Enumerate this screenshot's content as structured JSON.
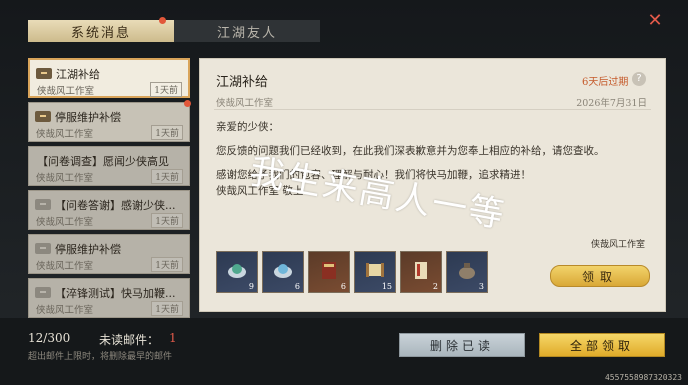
{
  "tabs": [
    {
      "label": "系统消息",
      "active": true,
      "has_dot": true
    },
    {
      "label": "江湖友人",
      "active": false,
      "has_dot": false
    }
  ],
  "close_icon": "close-icon",
  "mail_list": [
    {
      "title": "江湖补给",
      "sender": "侠哉风工作室",
      "time": "1天前",
      "selected": true,
      "read": false,
      "has_dot": false
    },
    {
      "title": "停服维护补偿",
      "sender": "侠哉风工作室",
      "time": "1天前",
      "selected": false,
      "read": false,
      "has_dot": true
    },
    {
      "title": "【问卷调查】愿闻少侠高见",
      "sender": "侠哉风工作室",
      "time": "1天前",
      "selected": false,
      "read": true,
      "has_dot": false
    },
    {
      "title": "【问卷答谢】感谢少侠...",
      "sender": "侠哉风工作室",
      "time": "1天前",
      "selected": false,
      "read": true,
      "has_dot": false
    },
    {
      "title": "停服维护补偿",
      "sender": "侠哉风工作室",
      "time": "1天前",
      "selected": false,
      "read": true,
      "has_dot": false
    },
    {
      "title": "【淬锋测试】快马加鞭...",
      "sender": "侠哉风工作室",
      "time": "1天前",
      "selected": false,
      "read": true,
      "has_dot": false
    }
  ],
  "detail": {
    "title": "江湖补给",
    "expire": "6天后过期",
    "help_icon": "?",
    "sender": "侠哉风工作室",
    "date": "2026年7月31日",
    "greeting": "亲爱的少侠：",
    "body1": "您反馈的问题我们已经收到，在此我们深表歉意并为您奉上相应的补给，请您查收。",
    "body2": "感谢您给予我们的包容、理解与耐心！我们将快马加鞭，追求精进！",
    "body3": "侠哉风工作室 敬上",
    "signature": "侠哉风工作室",
    "claim_label": "领取",
    "attachments": [
      {
        "icon": "jade-orb-icon",
        "count": "9",
        "bg": "blue"
      },
      {
        "icon": "pearl-orb-icon",
        "count": "6",
        "bg": "blue"
      },
      {
        "icon": "book-icon",
        "count": "6",
        "bg": "brown"
      },
      {
        "icon": "scroll-icon",
        "count": "15",
        "bg": "blue"
      },
      {
        "icon": "manual-icon",
        "count": "2",
        "bg": "brown"
      },
      {
        "icon": "pouch-icon",
        "count": "3",
        "bg": "blue"
      }
    ]
  },
  "overlay_text": "我生来高人一等",
  "footer": {
    "count": "12/300",
    "unread_label": "未读邮件：",
    "unread_count": "1",
    "hint": "超出邮件上限时，将删除最早的邮件",
    "delete_read_label": "删除已读",
    "claim_all_label": "全部领取",
    "uid": "4557558987320323"
  },
  "colors": {
    "accent_gold": "#e0ab2a",
    "alert_red": "#e25a4a",
    "expire_orange": "#c55a2b"
  }
}
